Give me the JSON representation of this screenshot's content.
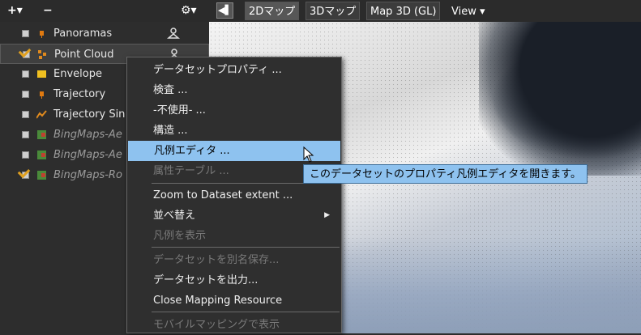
{
  "toolbar": {
    "add_label": "+▾",
    "remove_label": "−",
    "gear_label": "⚙▾",
    "tabs": [
      "2Dマップ",
      "3Dマップ",
      "Map 3D (GL)"
    ],
    "view_label": "View ▾"
  },
  "layers": [
    {
      "name": "Panoramas",
      "checked": false,
      "italic": false,
      "icon": "panorama-icon"
    },
    {
      "name": "Point Cloud",
      "checked": true,
      "italic": false,
      "icon": "point-cloud-icon"
    },
    {
      "name": "Envelope",
      "checked": false,
      "italic": false,
      "icon": "envelope-icon"
    },
    {
      "name": "Trajectory",
      "checked": false,
      "italic": false,
      "icon": "trajectory-icon"
    },
    {
      "name": "Trajectory Sin",
      "checked": false,
      "italic": false,
      "icon": "trajectory-line-icon"
    },
    {
      "name": "BingMaps-Ae",
      "checked": false,
      "italic": true,
      "icon": "bing-maps-icon"
    },
    {
      "name": "BingMaps-Ae",
      "checked": false,
      "italic": true,
      "icon": "bing-maps-icon"
    },
    {
      "name": "BingMaps-Ro",
      "checked": true,
      "italic": true,
      "icon": "bing-maps-icon"
    }
  ],
  "context_menu": {
    "items": [
      {
        "label": "データセットプロパティ ...",
        "disabled": false
      },
      {
        "label": "検査 ...",
        "disabled": false
      },
      {
        "label": "-不使用- ...",
        "disabled": false
      },
      {
        "label": "構造 ...",
        "disabled": false
      },
      {
        "label": "凡例エディタ ...",
        "disabled": false,
        "highlighted": true
      },
      {
        "label": "属性テーブル ...",
        "disabled": true
      },
      {
        "label": "Zoom to Dataset extent ...",
        "disabled": false
      },
      {
        "label": "並べ替え",
        "disabled": false,
        "submenu": true
      },
      {
        "label": "凡例を表示",
        "disabled": true
      },
      {
        "label": "データセットを別名保存...",
        "disabled": true
      },
      {
        "label": "データセットを出力...",
        "disabled": false
      },
      {
        "label": "Close Mapping Resource",
        "disabled": false
      },
      {
        "label": "モバイルマッピングで表示",
        "disabled": true
      }
    ],
    "submenu_arrow": "▶"
  },
  "tooltip": {
    "text": "このデータセットのプロパティ凡例エディタを開きます。"
  },
  "colors": {
    "highlight": "#8ec2ef",
    "background": "#2d2d2d",
    "accent_orange": "#e08a1e"
  }
}
